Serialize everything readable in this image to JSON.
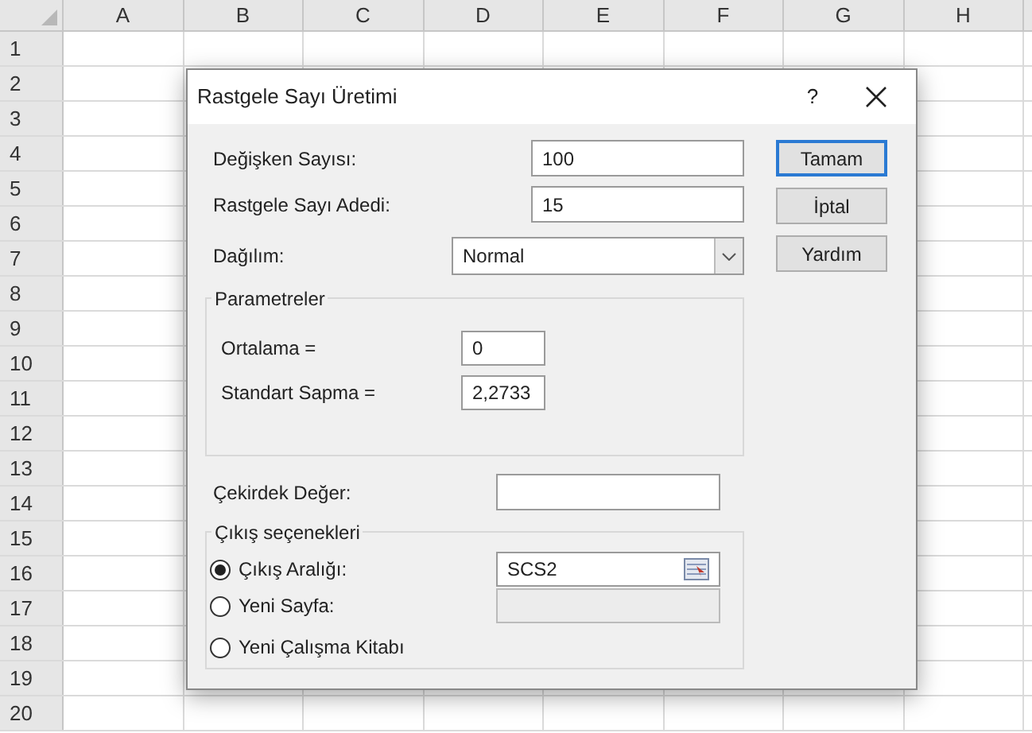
{
  "sheet": {
    "columns": [
      "A",
      "B",
      "C",
      "D",
      "E",
      "F",
      "G",
      "H"
    ],
    "rows": [
      "1",
      "2",
      "3",
      "4",
      "5",
      "6",
      "7",
      "8",
      "9",
      "10",
      "11",
      "12",
      "13",
      "14",
      "15",
      "16",
      "17",
      "18",
      "19",
      "20"
    ]
  },
  "dialog": {
    "title": "Rastgele Sayı Üretimi",
    "help": "?",
    "fields": [
      {
        "label": "Değişken Sayısı:",
        "value": "100"
      },
      {
        "label": "Rastgele Sayı Adedi:",
        "value": "15"
      }
    ],
    "distribution": {
      "label": "Dağılım:",
      "value": "Normal"
    },
    "parameters": {
      "title": "Parametreler",
      "fields": [
        {
          "label": "Ortalama =",
          "value": "0"
        },
        {
          "label": "Standart Sapma =",
          "value": "2,2733"
        }
      ]
    },
    "seed": {
      "label": "Çekirdek Değer:"
    },
    "output": {
      "title": "Çıkış seçenekleri",
      "options": [
        {
          "kind": "range",
          "label": "Çıkış Aralığı:",
          "selected": true,
          "value": "SCS2"
        },
        {
          "kind": "sheet",
          "label": "Yeni Sayfa:",
          "selected": false
        },
        {
          "kind": "workbook",
          "label": "Yeni Çalışma Kitabı",
          "selected": false
        }
      ]
    },
    "buttons": [
      {
        "label": "Tamam",
        "default": true
      },
      {
        "label": "İptal",
        "default": false
      },
      {
        "label": "Yardım",
        "default": false
      }
    ]
  }
}
